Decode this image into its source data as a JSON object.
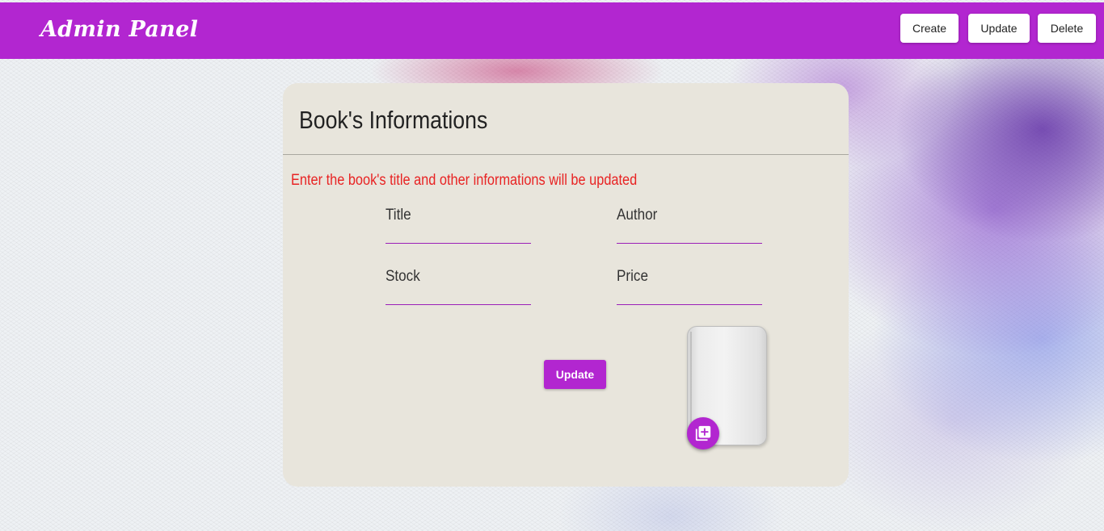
{
  "header": {
    "brand": "Admin Panel",
    "nav": {
      "create_label": "Create",
      "update_label": "Update",
      "delete_label": "Delete"
    }
  },
  "form": {
    "title": "Book's Informations",
    "hint": "Enter the book's title and other informations will be updated",
    "fields": {
      "title": {
        "label": "Title",
        "value": ""
      },
      "author": {
        "label": "Author",
        "value": ""
      },
      "stock": {
        "label": "Stock",
        "value": ""
      },
      "price": {
        "label": "Price",
        "value": ""
      }
    },
    "submit_label": "Update",
    "cover_upload_icon": "add-photo-library-icon"
  },
  "colors": {
    "primary": "#b226d0",
    "card_background": "#e8e5dc",
    "hint_text": "#e82323"
  }
}
